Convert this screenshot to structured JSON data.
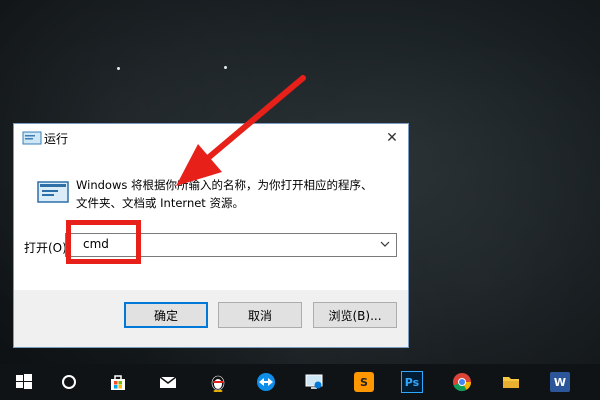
{
  "dialog": {
    "title": "运行",
    "description_line1": "Windows 将根据你所输入的名称，为你打开相应的程序、",
    "description_line2": "文件夹、文档或 Internet 资源。",
    "open_label": "打开(O)",
    "input_value": "cmd",
    "buttons": {
      "ok": "确定",
      "cancel": "取消",
      "browse": "浏览(B)..."
    }
  },
  "annotation": {
    "color": "#e8201a"
  },
  "taskbar": {
    "items": [
      {
        "icon": "windows-start-icon"
      },
      {
        "icon": "cortana-search-icon"
      },
      {
        "icon": "store-icon"
      },
      {
        "icon": "mail-icon"
      },
      {
        "icon": "qq-penguin-icon"
      },
      {
        "icon": "teamviewer-icon"
      },
      {
        "icon": "remote-desktop-icon"
      },
      {
        "icon": "sublime-text-icon",
        "label": "S"
      },
      {
        "icon": "photoshop-icon",
        "label": "Ps"
      },
      {
        "icon": "chrome-icon"
      },
      {
        "icon": "file-explorer-icon"
      },
      {
        "icon": "word-icon",
        "label": "W"
      }
    ]
  }
}
